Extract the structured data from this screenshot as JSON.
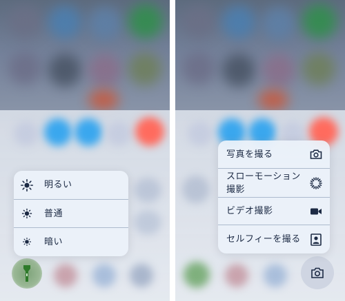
{
  "brightness_menu": {
    "items": [
      {
        "label": "明るい",
        "icon": "sun-high-icon"
      },
      {
        "label": "普通",
        "icon": "sun-medium-icon"
      },
      {
        "label": "暗い",
        "icon": "sun-low-icon"
      }
    ]
  },
  "camera_menu": {
    "items": [
      {
        "label": "写真を撮る",
        "icon": "camera-icon"
      },
      {
        "label": "スローモーション撮影",
        "icon": "slowmo-icon"
      },
      {
        "label": "ビデオ撮影",
        "icon": "video-icon"
      },
      {
        "label": "セルフィーを撮る",
        "icon": "selfie-icon"
      }
    ]
  },
  "colors": {
    "menu_text": "#1c2a44",
    "icon": "#1c2a44",
    "flashlight_green": "#2e7a2a",
    "toggle_blue": "#3aa7ee",
    "toggle_red": "#ff6b5e"
  }
}
